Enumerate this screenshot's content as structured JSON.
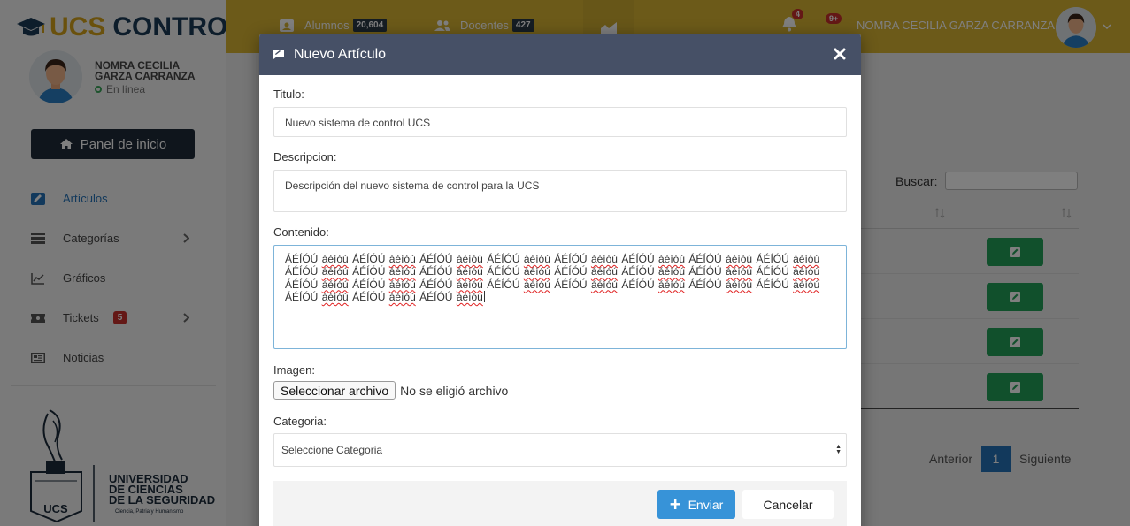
{
  "app": {
    "brand_main": "UCS",
    "brand_sub": "CONTROL"
  },
  "sidebar": {
    "user_name": "NOMRA CECILIA GARZA CARRANZA",
    "user_status": "En línea",
    "home_button": "Panel de inicio",
    "items": [
      {
        "label": "Artículos",
        "icon": "edit-icon",
        "active": true
      },
      {
        "label": "Categorías",
        "icon": "table-icon",
        "has_submenu": true
      },
      {
        "label": "Gráficos",
        "icon": "line-chart-icon"
      },
      {
        "label": "Tickets",
        "icon": "ticket-icon",
        "badge": "5",
        "has_submenu": true
      },
      {
        "label": "Noticias",
        "icon": "newspaper-icon"
      }
    ],
    "university": {
      "lines": [
        "UNIVERSIDAD",
        "DE CIENCIAS",
        "DE LA SEGURIDAD"
      ],
      "motto": "Ciencia, Patria y Humanismo",
      "shield_text": "UCS"
    }
  },
  "topbar": {
    "alumnos_label": "Alumnos",
    "alumnos_count": "20,604",
    "docentes_label": "Docentes",
    "docentes_count": "427",
    "notif_bell_count": "4",
    "notif_count_2": "9+",
    "user_name": "NOMRA CECILIA GARZA CARRANZA"
  },
  "background_page": {
    "search_label": "Buscar:",
    "pager_prev": "Anterior",
    "pager_current": "1",
    "pager_next": "Siguiente"
  },
  "modal": {
    "title": "Nuevo Artículo",
    "titulo_label": "Titulo:",
    "titulo_value": "Nuevo sistema de control UCS",
    "descripcion_label": "Descripcion:",
    "descripcion_value": "Descripción del nuevo sistema de control para la UCS",
    "contenido_label": "Contenido:",
    "contenido_unit_upper": "ÁÉÍÓÚ",
    "contenido_unit_lower": "áéíóú",
    "contenido_pairs": 27,
    "imagen_label": "Imagen:",
    "file_button": "Seleccionar archivo",
    "file_status": "No se eligió archivo",
    "categoria_label": "Categoria:",
    "categoria_selected": "Seleccione Categoria",
    "send_button": "Enviar",
    "cancel_button": "Cancelar"
  },
  "colors": {
    "accent_blue": "#3793d8",
    "header_dark": "#465066",
    "topbar_gold": "#d8b433",
    "success_green": "#23a059",
    "danger_red": "#c9302c"
  }
}
